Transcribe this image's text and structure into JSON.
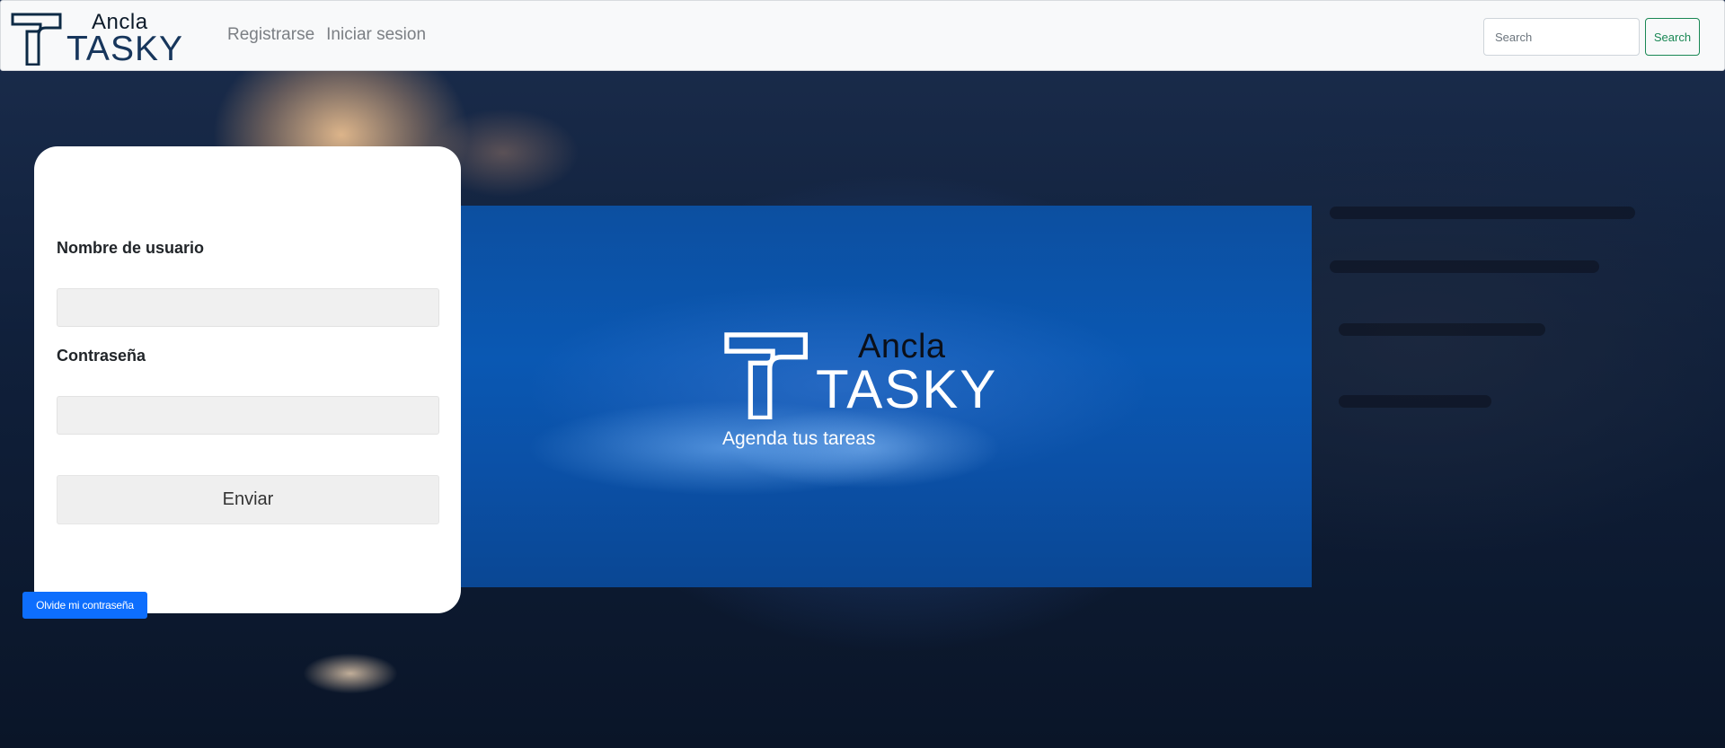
{
  "navbar": {
    "brand": {
      "ancla": "Ancla",
      "tasky": "TASKY"
    },
    "links": [
      "Registrarse",
      "Iniciar sesion"
    ],
    "search": {
      "placeholder": "Search",
      "button_label": "Search"
    }
  },
  "login_form": {
    "username_label": "Nombre de usuario",
    "username_value": "",
    "password_label": "Contraseña",
    "password_value": "",
    "submit_label": "Enviar",
    "forgot_label": "Olvide mi contraseña"
  },
  "hero": {
    "ancla": "Ancla",
    "tasky": "TASKY",
    "tagline": "Agenda tus tareas"
  },
  "icons": {
    "brand_logo": "tasky-t-logo-icon"
  },
  "colors": {
    "navbar_bg": "#f8f9fa",
    "nav_link": "#7b7f84",
    "search_button": "#198754",
    "primary_button": "#0d6efd",
    "hero_blue": "#0a58b3",
    "brand_dark": "#17365c"
  }
}
